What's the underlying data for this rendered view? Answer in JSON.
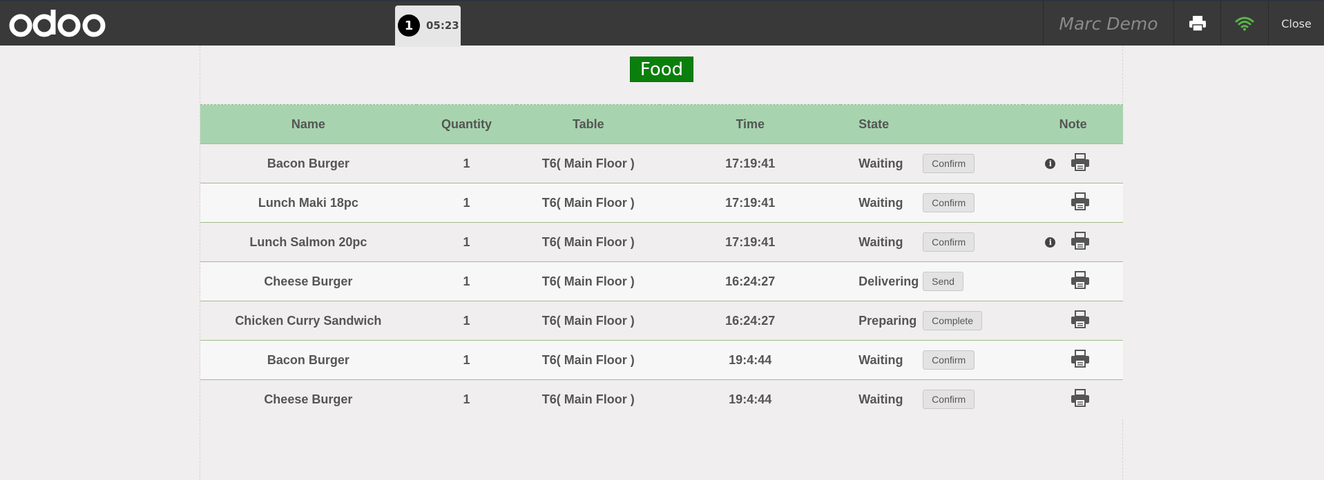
{
  "header": {
    "logo_text": "odoo",
    "order_tab": {
      "number": "1",
      "time": "05:23"
    },
    "username": "Marc Demo",
    "close_label": "Close",
    "colors": {
      "bar": "#393939",
      "wifi": "#5bb54a"
    }
  },
  "category": {
    "title": "Food",
    "color": "#0b7f0b"
  },
  "table": {
    "columns": [
      "Name",
      "Quantity",
      "Table",
      "Time",
      "State",
      "Note"
    ],
    "header_color": "#a7d4ae",
    "rows": [
      {
        "name": "Bacon Burger",
        "qty": "1",
        "table": "T6( Main Floor )",
        "time": "17:19:41",
        "state": "Waiting",
        "action": "Confirm",
        "has_note": true
      },
      {
        "name": "Lunch Maki 18pc",
        "qty": "1",
        "table": "T6( Main Floor )",
        "time": "17:19:41",
        "state": "Waiting",
        "action": "Confirm",
        "has_note": false
      },
      {
        "name": "Lunch Salmon 20pc",
        "qty": "1",
        "table": "T6( Main Floor )",
        "time": "17:19:41",
        "state": "Waiting",
        "action": "Confirm",
        "has_note": true
      },
      {
        "name": "Cheese Burger",
        "qty": "1",
        "table": "T6( Main Floor )",
        "time": "16:24:27",
        "state": "Delivering",
        "action": "Send",
        "has_note": false
      },
      {
        "name": "Chicken Curry Sandwich",
        "qty": "1",
        "table": "T6( Main Floor )",
        "time": "16:24:27",
        "state": "Preparing",
        "action": "Complete",
        "has_note": false
      },
      {
        "name": "Bacon Burger",
        "qty": "1",
        "table": "T6( Main Floor )",
        "time": "19:4:44",
        "state": "Waiting",
        "action": "Confirm",
        "has_note": false
      },
      {
        "name": "Cheese Burger",
        "qty": "1",
        "table": "T6( Main Floor )",
        "time": "19:4:44",
        "state": "Waiting",
        "action": "Confirm",
        "has_note": false
      }
    ],
    "icons": {
      "note": "info-icon",
      "print": "printer-icon"
    }
  }
}
